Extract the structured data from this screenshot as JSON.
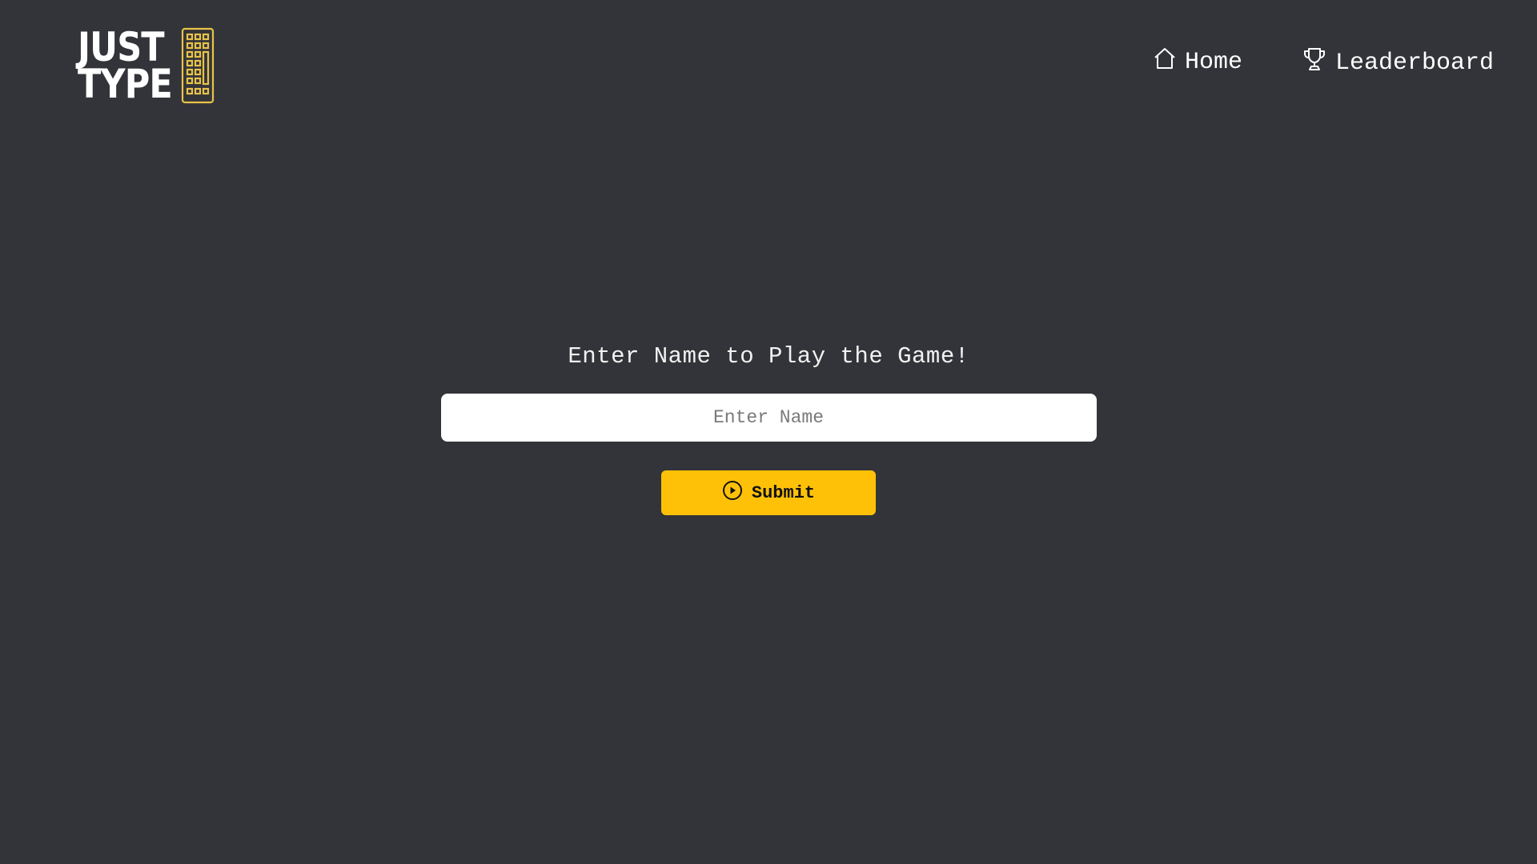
{
  "logo": {
    "line1": "JUST",
    "line2": "TYPE",
    "accent_color": "#e9c349",
    "icon": "keyboard-icon"
  },
  "nav": {
    "items": [
      {
        "label": "Home",
        "icon": "home-icon"
      },
      {
        "label": "Leaderboard",
        "icon": "trophy-icon"
      }
    ]
  },
  "main": {
    "prompt": "Enter Name to Play the Game!",
    "name_input": {
      "placeholder": "Enter Name",
      "value": ""
    },
    "submit": {
      "label": "Submit",
      "icon": "play-circle-icon",
      "color": "#ffc107"
    }
  },
  "theme": {
    "background": "#333439",
    "text": "#ffffff"
  }
}
